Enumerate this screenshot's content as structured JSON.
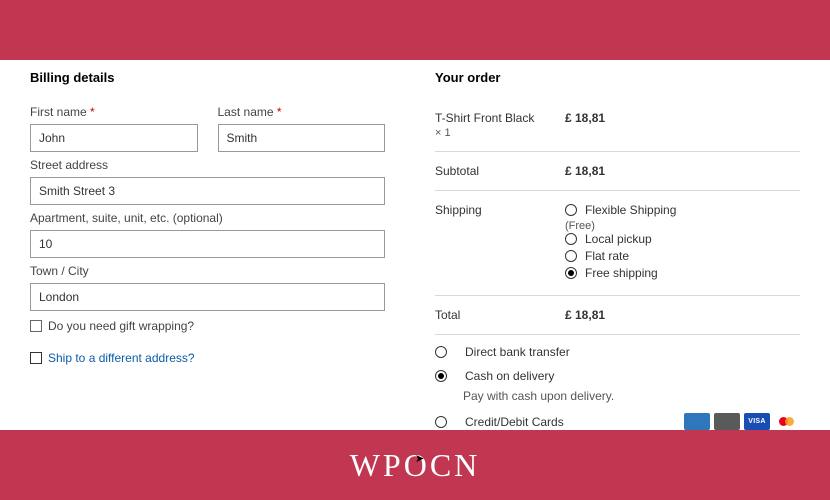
{
  "header": {
    "billing_title": "Billing details",
    "order_title": "Your order"
  },
  "fields": {
    "first_name_label": "First name",
    "first_name_value": "John",
    "last_name_label": "Last name",
    "last_name_value": "Smith",
    "street_label": "Street address",
    "street_value": "Smith Street 3",
    "apt_label": "Apartment, suite, unit, etc. (optional)",
    "apt_value": "10",
    "city_label": "Town / City",
    "city_value": "London",
    "required": "*",
    "gift_wrap": "Do you need gift wrapping?",
    "ship_diff": "Ship to a different address?"
  },
  "order": {
    "product_name": "T-Shirt Front Black",
    "product_qty": "× 1",
    "product_price": "£ 18,81",
    "subtotal_label": "Subtotal",
    "subtotal_value": "£ 18,81",
    "shipping_label": "Shipping",
    "total_label": "Total",
    "total_value": "£ 18,81"
  },
  "shipping": {
    "flex": "Flexible Shipping",
    "flex_note": "(Free)",
    "pickup": "Local pickup",
    "flat": "Flat rate",
    "free": "Free shipping"
  },
  "payment": {
    "bank": "Direct bank transfer",
    "cash": "Cash on delivery",
    "cash_note": "Pay with cash upon delivery.",
    "card": "Credit/Debit Cards",
    "visa": "VISA"
  },
  "footer": {
    "logo": "WPOCN"
  }
}
